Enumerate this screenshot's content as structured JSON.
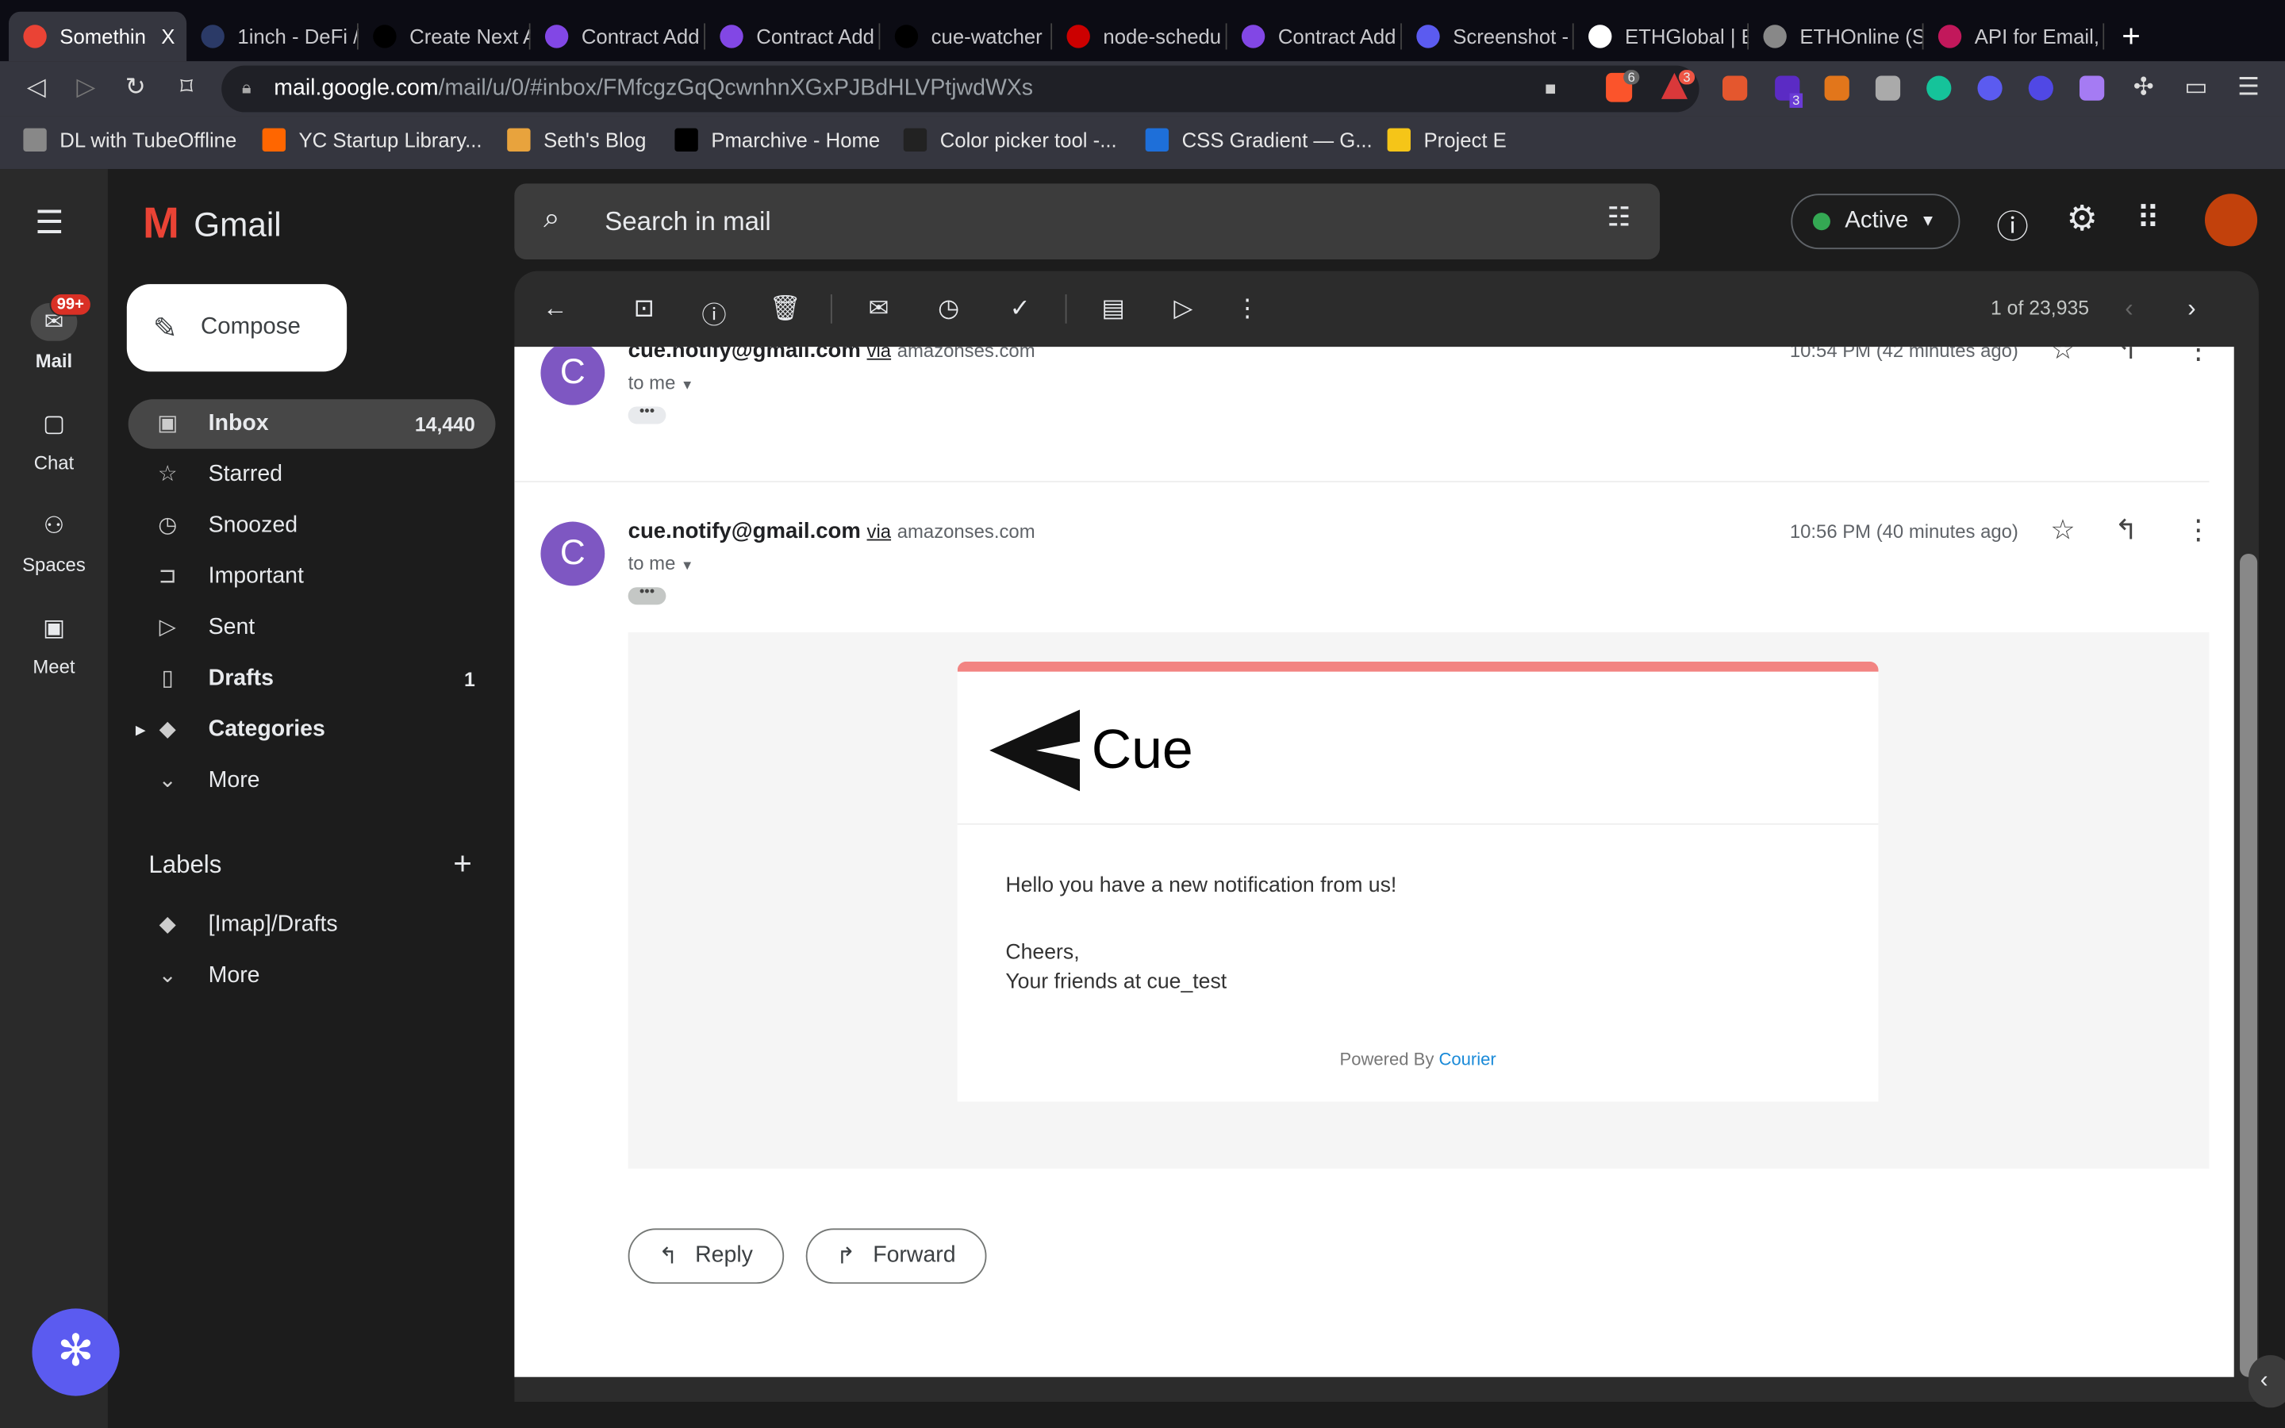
{
  "browser": {
    "tabs": [
      {
        "title": "Somethin",
        "active": true,
        "color": "#ea4335"
      },
      {
        "title": "1inch - DeFi /",
        "color": "#2b3a67"
      },
      {
        "title": "Create Next A",
        "color": "#000000"
      },
      {
        "title": "Contract Add",
        "color": "#8247e5"
      },
      {
        "title": "Contract Add",
        "color": "#8247e5"
      },
      {
        "title": "cue-watcher",
        "color": "#000000"
      },
      {
        "title": "node-schedu",
        "color": "#cc0000"
      },
      {
        "title": "Contract Add",
        "color": "#8247e5"
      },
      {
        "title": "Screenshot -",
        "color": "#5b5bf0"
      },
      {
        "title": "ETHGlobal | E",
        "color": "#ffffff"
      },
      {
        "title": "ETHOnline (S",
        "color": "#888888"
      },
      {
        "title": "API for Email,",
        "color": "#c2185b"
      }
    ],
    "close_tab": "X",
    "new_tab": "+",
    "url_host": "mail.google.com",
    "url_path": "/mail/u/0/#inbox/FMfcgzGqQcwnhnXGxPJBdHLVPtjwdWXs",
    "ext_badges": [
      "6",
      "3",
      "3"
    ],
    "bookmarks": [
      {
        "label": "DL with TubeOffline",
        "color": "#888888"
      },
      {
        "label": "YC Startup Library...",
        "color": "#ff6600"
      },
      {
        "label": "Seth's Blog",
        "color": "#e8a33d"
      },
      {
        "label": "Pmarchive - Home",
        "color": "#000000"
      },
      {
        "label": "Color picker tool -...",
        "color": "#222222"
      },
      {
        "label": "CSS Gradient — G...",
        "color": "#1e6fd9"
      },
      {
        "label": "Project E",
        "color": "#f5c518"
      }
    ]
  },
  "gmail": {
    "logo": "Gmail",
    "search_placeholder": "Search in mail",
    "status": "Active",
    "rail": [
      {
        "label": "Mail",
        "badge": "99+"
      },
      {
        "label": "Chat"
      },
      {
        "label": "Spaces"
      },
      {
        "label": "Meet"
      }
    ],
    "compose": "Compose",
    "folders": [
      {
        "label": "Inbox",
        "count": "14,440",
        "icon": "inbox-icon",
        "glyph": "▣"
      },
      {
        "label": "Starred",
        "icon": "star-icon",
        "glyph": "☆"
      },
      {
        "label": "Snoozed",
        "icon": "clock-icon",
        "glyph": "◷"
      },
      {
        "label": "Important",
        "icon": "important-icon",
        "glyph": "⊐"
      },
      {
        "label": "Sent",
        "icon": "send-icon",
        "glyph": "▷"
      },
      {
        "label": "Drafts",
        "count": "1",
        "icon": "draft-icon",
        "glyph": "▯"
      },
      {
        "label": "Categories",
        "icon": "label-icon",
        "glyph": "◆"
      },
      {
        "label": "More",
        "icon": "chevron-down-icon",
        "glyph": "⌄"
      }
    ],
    "labels_title": "Labels",
    "labels": [
      {
        "label": "[Imap]/Drafts"
      },
      {
        "label": "More"
      }
    ],
    "pager": "1 of 23,935",
    "messages": [
      {
        "avatar": "C",
        "sender": "cue.notify@gmail.com",
        "via": "via",
        "domain": "amazonses.com",
        "to": "to me",
        "time": "10:54 PM (42 minutes ago)"
      },
      {
        "avatar": "C",
        "sender": "cue.notify@gmail.com",
        "via": "via",
        "domain": "amazonses.com",
        "to": "to me",
        "time": "10:56 PM (40 minutes ago)"
      }
    ],
    "email": {
      "brand": "Cue",
      "line1": "Hello you have a new notification from us!",
      "line2": "Cheers,",
      "line3": "Your friends at cue_test",
      "powered": "Powered By",
      "courier": "Courier",
      "accent": "#f28482"
    },
    "reply": "Reply",
    "forward": "Forward"
  }
}
